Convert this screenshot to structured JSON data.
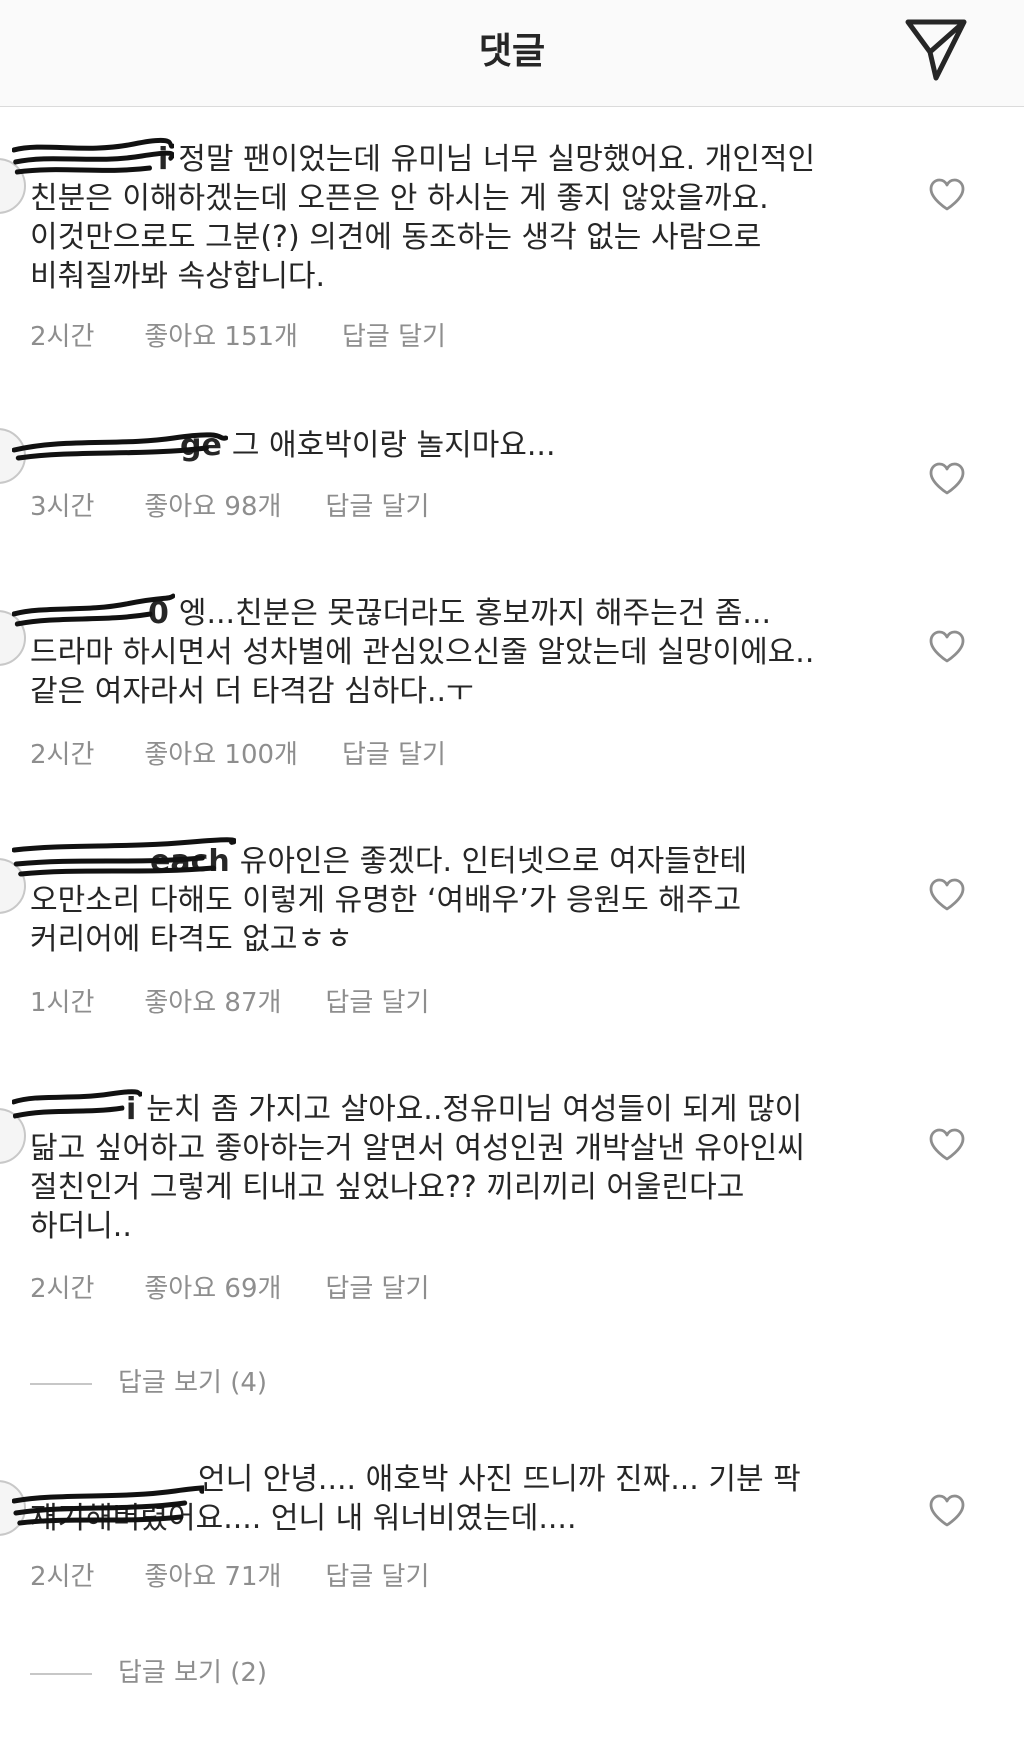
{
  "header": {
    "title": "댓글",
    "icon": "paper-plane-icon"
  },
  "colors": {
    "text": "#262626",
    "meta": "#8e8e8e",
    "header_bg": "#fafafa",
    "divider": "#dbdbdb"
  },
  "comments": [
    {
      "username": "i",
      "text": "정말 팬이었는데 유미님 너무 실망했어요. 개인적인\n친분은 이해하겠는데 오픈은 안 하시는 게 좋지 않았을까요.\n이것만으로도 그분(?) 의견에 동조하는 생각 없는 사람으로\n비춰질까봐 속상합니다.",
      "time": "2시간",
      "likes": "좋아요 151개",
      "reply": "답글 달기"
    },
    {
      "username": "ge",
      "text": "그 애호박이랑 놀지마요...",
      "time": "3시간",
      "likes": "좋아요 98개",
      "reply": "답글 달기"
    },
    {
      "username": "0",
      "text": "엥...친분은 못끊더라도 홍보까지 해주는건 좀...\n드라마 하시면서 성차별에 관심있으신줄 알았는데 실망이에요..\n같은 여자라서 더 타격감 심하다..ㅜ",
      "time": "2시간",
      "likes": "좋아요 100개",
      "reply": "답글 달기"
    },
    {
      "username": "each",
      "text": "유아인은 좋겠다. 인터넷으로 여자들한테\n오만소리 다해도 이렇게 유명한 ‘여배우’가 응원도 해주고\n커리어에 타격도 없고ㅎㅎ",
      "time": "1시간",
      "likes": "좋아요 87개",
      "reply": "답글 달기"
    },
    {
      "username": "i",
      "text": "눈치 좀 가지고 살아요..정유미님 여성들이 되게 많이\n닮고 싶어하고 좋아하는거 알면서 여성인권 개박살낸 유아인씨\n절친인거 그렇게 티내고 싶었나요?? 끼리끼리 어울린다고\n하더니..",
      "time": "2시간",
      "likes": "좋아요 69개",
      "reply": "답글 달기",
      "view_replies": "답글 보기 (4)"
    },
    {
      "username": "",
      "text": "언니 안녕.... 애호박 사진 뜨니까 진짜... 기분 팍\n재기해버렸어요.... 언니 내 워너비였는데....",
      "time": "2시간",
      "likes": "좋아요 71개",
      "reply": "답글 달기",
      "view_replies": "답글 보기 (2)"
    }
  ],
  "icons": {
    "like": "heart-icon",
    "avatar": "avatar",
    "redaction": "scribble-redaction"
  }
}
